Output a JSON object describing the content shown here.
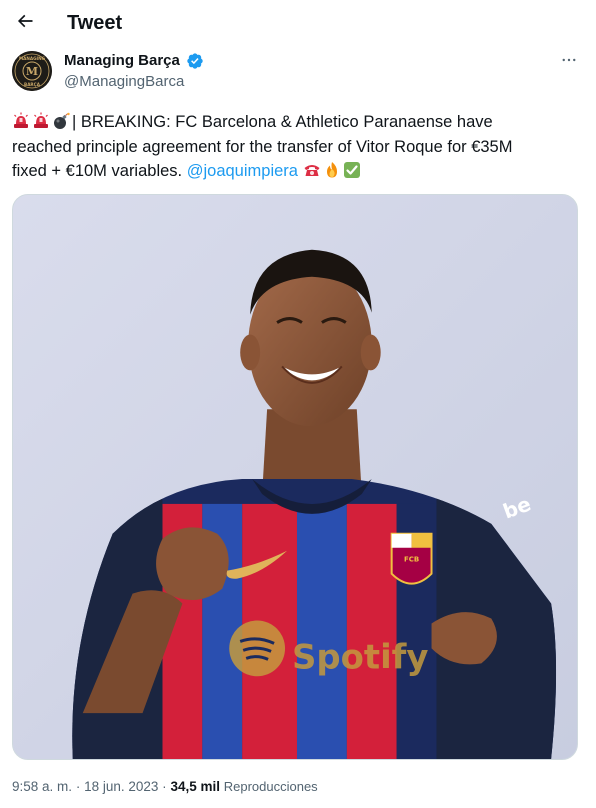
{
  "header": {
    "title": "Tweet",
    "back_icon": "arrow-left-icon"
  },
  "author": {
    "name": "Managing Barça",
    "handle": "@ManagingBarca",
    "avatar_text_top": "MANAGING",
    "avatar_letter": "M",
    "avatar_text_bottom": "BARÇA",
    "verified_color": "#1d9bf0"
  },
  "tweet": {
    "line1_text": "| BREAKING: FC Barcelona & Athletico Paranaense have",
    "line2_text": "reached principle agreement for the transfer of Vitor Roque for €35M",
    "line3_text": "fixed + €10M variables.",
    "mention": "@joaquimpiera",
    "emojis_leading": [
      "siren-icon",
      "siren-icon",
      "bomb-icon"
    ],
    "emojis_trailing": [
      "telephone-icon",
      "fire-icon",
      "check-mark-icon"
    ]
  },
  "media": {
    "shirt_sponsor": "Spotify",
    "sleeve_sponsor": "be",
    "crest_letters": "FCB"
  },
  "meta": {
    "time": "9:58 a. m.",
    "separator": "·",
    "date": "18 jun. 2023",
    "views_count": "34,5 mil",
    "views_label": "Reproducciones"
  },
  "colors": {
    "accent": "#1d9bf0",
    "text_primary": "#0f1419",
    "text_secondary": "#536471",
    "border": "#cfd9de"
  }
}
